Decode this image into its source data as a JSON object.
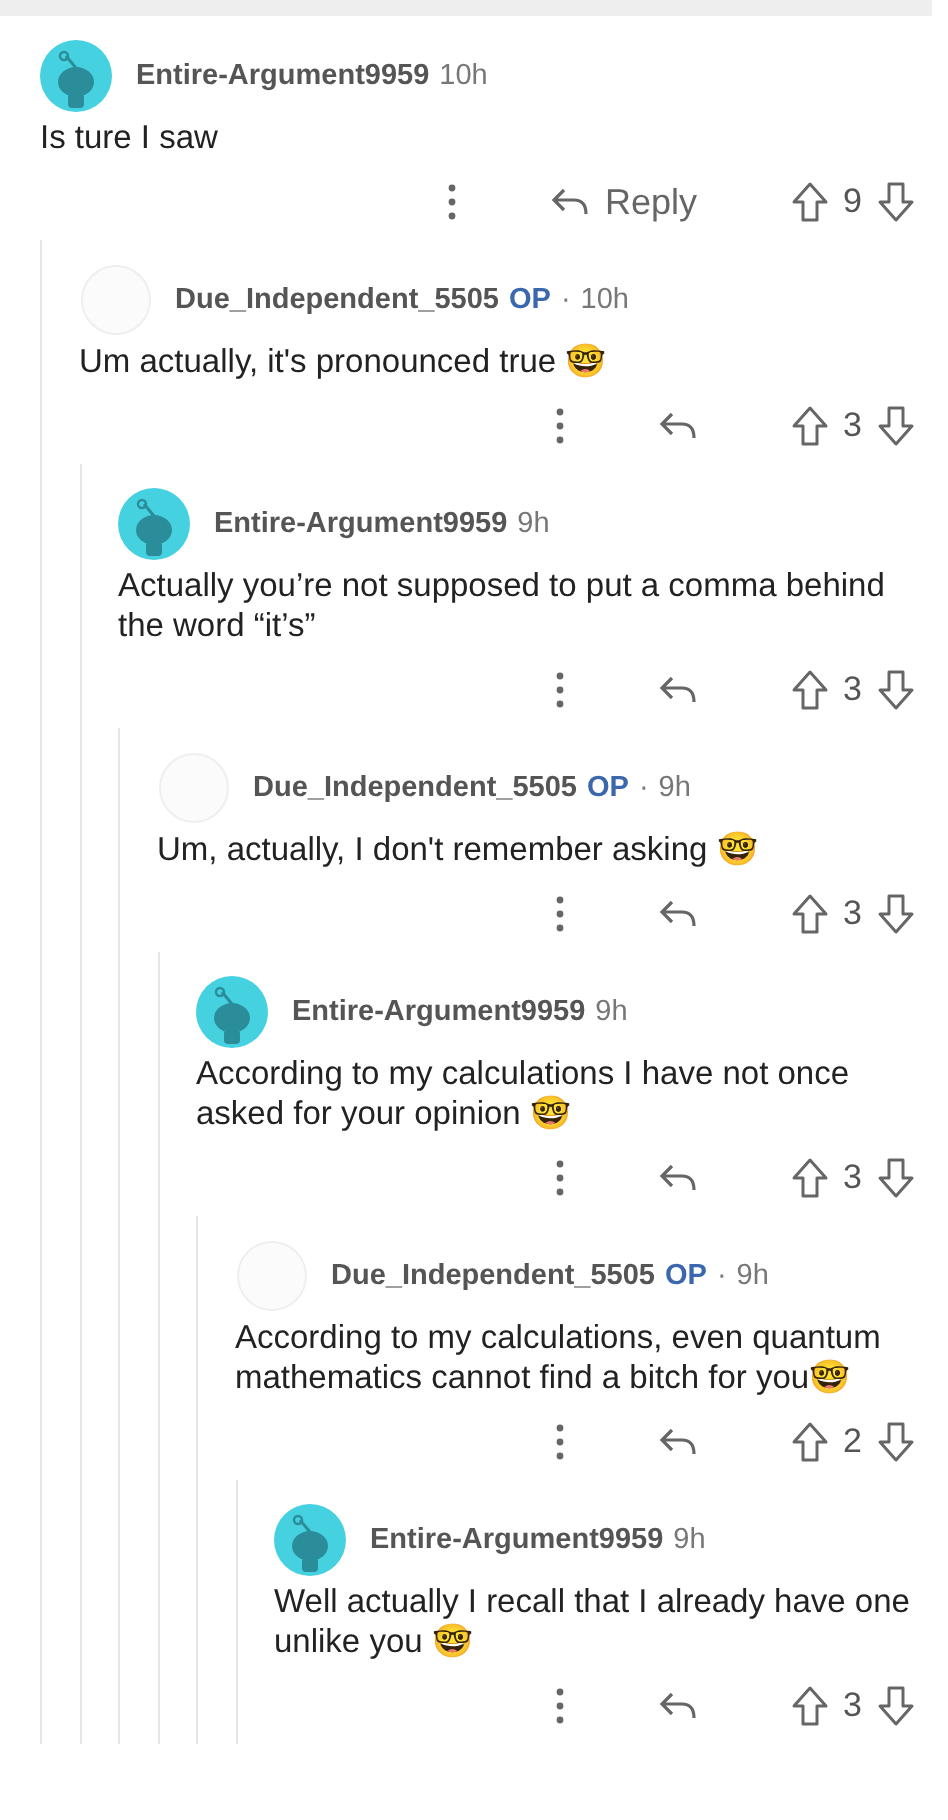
{
  "comments": [
    {
      "author": "Entire-Argument9959",
      "time": "10h",
      "avatar_image": true,
      "body": "Is ture I saw",
      "reply_label": "Reply",
      "score": "9",
      "children": [
        {
          "author": "Due_Independent_5505",
          "op_label": "OP",
          "separator": "·",
          "time": "10h",
          "avatar_image": false,
          "body": "Um actually, it's pronounced true 🤓",
          "score": "3",
          "children": [
            {
              "author": "Entire-Argument9959",
              "time": "9h",
              "avatar_image": true,
              "body": "Actually you’re not supposed to put a comma behind  the word “it’s”",
              "score": "3",
              "children": [
                {
                  "author": "Due_Independent_5505",
                  "op_label": "OP",
                  "separator": "·",
                  "time": "9h",
                  "avatar_image": false,
                  "body": "Um, actually, I don't remember asking 🤓",
                  "score": "3",
                  "children": [
                    {
                      "author": "Entire-Argument9959",
                      "time": "9h",
                      "avatar_image": true,
                      "body": "According to my calculations I have not once asked for your opinion 🤓",
                      "score": "3",
                      "children": [
                        {
                          "author": "Due_Independent_5505",
                          "op_label": "OP",
                          "separator": "·",
                          "time": "9h",
                          "avatar_image": false,
                          "body": "According to my calculations, even quantum mathematics cannot find a bitch for you🤓",
                          "score": "2",
                          "children": [
                            {
                              "author": "Entire-Argument9959",
                              "time": "9h",
                              "avatar_image": true,
                              "body": "Well actually I recall that I already have one unlike you 🤓",
                              "score": "3"
                            }
                          ]
                        }
                      ]
                    }
                  ]
                }
              ]
            }
          ]
        }
      ]
    }
  ]
}
